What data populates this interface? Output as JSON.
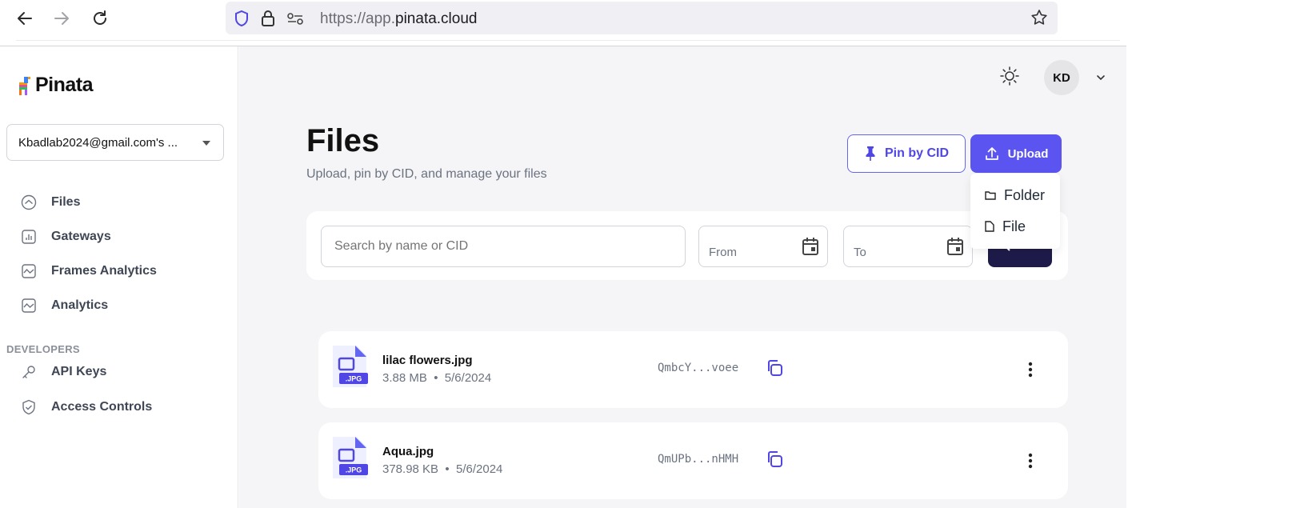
{
  "browser": {
    "url_prefix": "https://app.",
    "url_domain": "pinata.cloud"
  },
  "sidebar": {
    "logo_text": "Pinata",
    "account_label": "Kbadlab2024@gmail.com's ...",
    "items": [
      {
        "label": "Files",
        "icon": "home-icon"
      },
      {
        "label": "Gateways",
        "icon": "bar-chart-icon"
      },
      {
        "label": "Frames Analytics",
        "icon": "line-chart-icon"
      },
      {
        "label": "Analytics",
        "icon": "line-chart-icon"
      }
    ],
    "developers_label": "DEVELOPERS",
    "dev_items": [
      {
        "label": "API Keys",
        "icon": "key-icon"
      },
      {
        "label": "Access Controls",
        "icon": "shield-check-icon"
      }
    ]
  },
  "header": {
    "avatar_initials": "KD",
    "theme_icon": "sun-icon"
  },
  "page": {
    "title": "Files",
    "subtitle": "Upload, pin by CID, and manage your files",
    "pin_button": "Pin by CID",
    "upload_button": "Upload",
    "upload_menu": [
      "Folder",
      "File"
    ]
  },
  "filters": {
    "search_placeholder": "Search by name or CID",
    "from_label": "From",
    "to_label": "To"
  },
  "files": [
    {
      "name": "lilac flowers.jpg",
      "size": "3.88 MB",
      "date": "5/6/2024",
      "cid": "QmbcY...voee",
      "ext": ".JPG"
    },
    {
      "name": "Aqua.jpg",
      "size": "378.98 KB",
      "date": "5/6/2024",
      "cid": "QmUPb...nHMH",
      "ext": ".JPG"
    }
  ],
  "colors": {
    "accent": "#5b54f0",
    "accent_dark": "#1e1b4b",
    "file_icon": "#6366f1"
  }
}
